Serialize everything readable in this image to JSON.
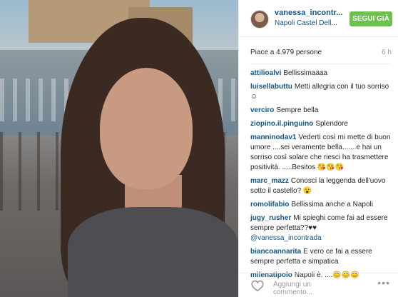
{
  "post": {
    "username": "vanessa_incontr...",
    "location": "Napoli Castel Dell...",
    "follow_label": "SEGUI GIÀ",
    "likes": "Piace a 4.979 persone",
    "time": "6 h"
  },
  "comments": [
    {
      "user": "attilioalvi",
      "text": "Bellissimaaaa"
    },
    {
      "user": "luisellabuttu",
      "text": "Metti allegria con il tuo sorriso ☺"
    },
    {
      "user": "verciro",
      "text": "Sempre bella"
    },
    {
      "user": "ziopino.il.pinguino",
      "text": "Splendore"
    },
    {
      "user": "manninodav1",
      "text": "Vederti così mi mette di buon umore ....sei veramente bella.......e hai un sorriso così solare che riesci ha trasmettere positività. .....Besitos 😘😘😘"
    },
    {
      "user": "marc_mazz",
      "text": "Conosci la leggenda dell'uovo sotto il castello? 😮"
    },
    {
      "user": "romolifabio",
      "text": "Bellissima anche a Napoli"
    },
    {
      "user": "jugy_rusher",
      "text": "Mi spieghi come fai ad essere sempre perfetta??♥♥",
      "mention": "@vanessa_incontrada"
    },
    {
      "user": "biancoannarita",
      "text": "E vero ce fai a essere sempre perfetta e simpatica"
    },
    {
      "user": "milenatipolo",
      "text": "Napoli è. ....😊😊😊"
    }
  ],
  "footer": {
    "add_comment_placeholder": "Aggiungi un commento...",
    "more_label": "•••"
  },
  "icons": {
    "heart": "heart-outline-icon",
    "more": "more-options-icon"
  },
  "colors": {
    "link": "#125688",
    "follow_button": "#70c050"
  }
}
